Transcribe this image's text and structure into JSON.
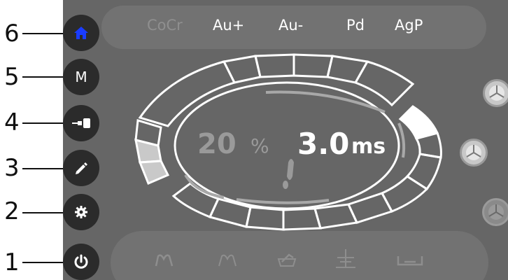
{
  "callouts": [
    "6",
    "5",
    "4",
    "3",
    "2",
    "1"
  ],
  "materials": [
    {
      "label": "CoCr",
      "active": false
    },
    {
      "label": "Au+",
      "active": true
    },
    {
      "label": "Au-",
      "active": true
    },
    {
      "label": "Pd",
      "active": true
    },
    {
      "label": "AgP",
      "active": true
    }
  ],
  "side_buttons": {
    "home_icon": "home-icon",
    "mode_label": "M",
    "connector_icon": "connector-icon",
    "edit_icon": "pencil-icon",
    "settings_icon": "gear-icon",
    "power_icon": "power-icon"
  },
  "readout": {
    "percent_value": "20",
    "percent_unit": "%",
    "time_value": "3.0",
    "time_unit": "ms"
  },
  "bottom_icons": [
    "wave-icon",
    "arch-icon",
    "crown-icon",
    "implant-icon",
    "bridge-icon"
  ],
  "right_icons": [
    "electrode-icon",
    "electrode-icon",
    "electrode-icon"
  ],
  "colors": {
    "screen": "#666666",
    "button": "#2b2b2b",
    "home_accent": "#1a3cff",
    "text": "#ffffff",
    "dim_text": "#9a9a9a"
  }
}
